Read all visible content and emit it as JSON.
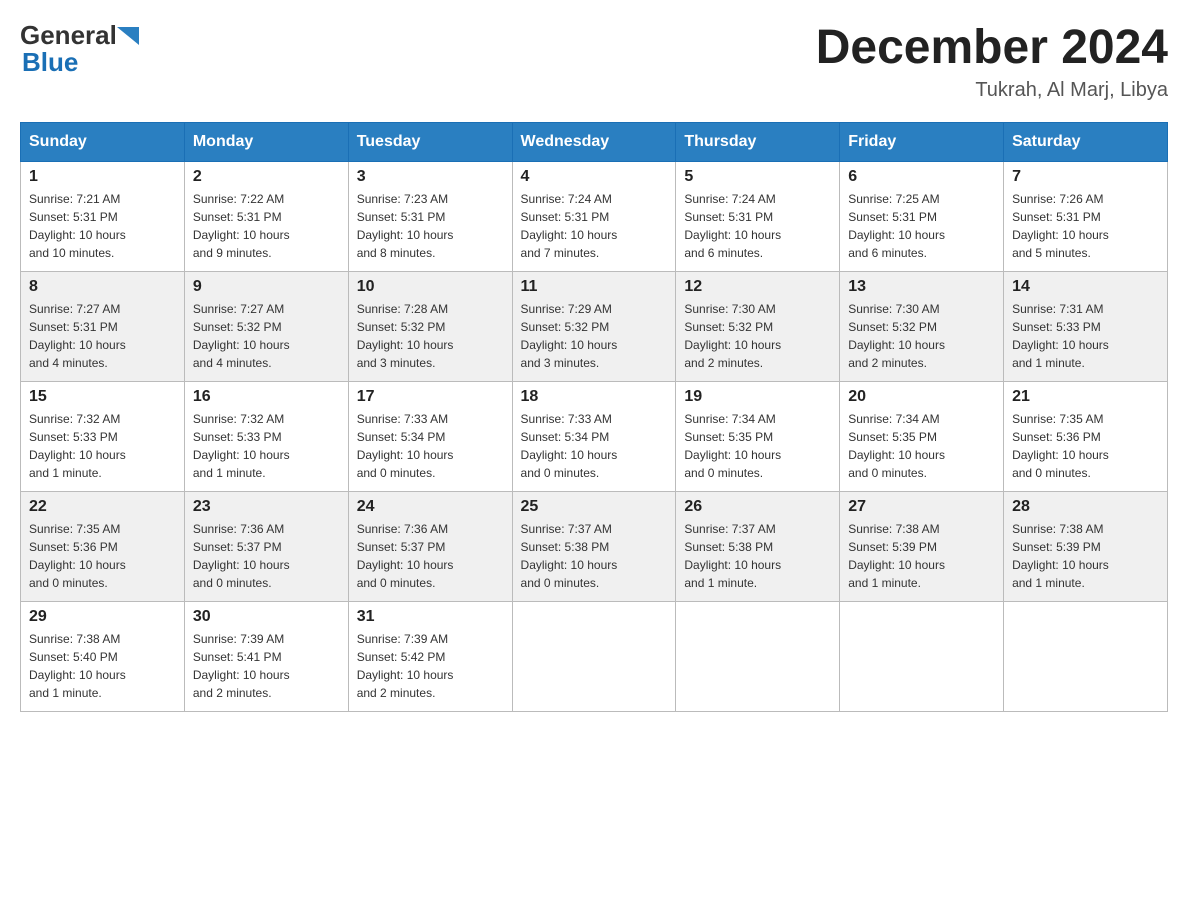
{
  "logo": {
    "line1": "General",
    "line2": "Blue"
  },
  "header": {
    "month_year": "December 2024",
    "location": "Tukrah, Al Marj, Libya"
  },
  "weekdays": [
    "Sunday",
    "Monday",
    "Tuesday",
    "Wednesday",
    "Thursday",
    "Friday",
    "Saturday"
  ],
  "weeks": [
    [
      {
        "day": "1",
        "sunrise": "7:21 AM",
        "sunset": "5:31 PM",
        "daylight": "10 hours and 10 minutes."
      },
      {
        "day": "2",
        "sunrise": "7:22 AM",
        "sunset": "5:31 PM",
        "daylight": "10 hours and 9 minutes."
      },
      {
        "day": "3",
        "sunrise": "7:23 AM",
        "sunset": "5:31 PM",
        "daylight": "10 hours and 8 minutes."
      },
      {
        "day": "4",
        "sunrise": "7:24 AM",
        "sunset": "5:31 PM",
        "daylight": "10 hours and 7 minutes."
      },
      {
        "day": "5",
        "sunrise": "7:24 AM",
        "sunset": "5:31 PM",
        "daylight": "10 hours and 6 minutes."
      },
      {
        "day": "6",
        "sunrise": "7:25 AM",
        "sunset": "5:31 PM",
        "daylight": "10 hours and 6 minutes."
      },
      {
        "day": "7",
        "sunrise": "7:26 AM",
        "sunset": "5:31 PM",
        "daylight": "10 hours and 5 minutes."
      }
    ],
    [
      {
        "day": "8",
        "sunrise": "7:27 AM",
        "sunset": "5:31 PM",
        "daylight": "10 hours and 4 minutes."
      },
      {
        "day": "9",
        "sunrise": "7:27 AM",
        "sunset": "5:32 PM",
        "daylight": "10 hours and 4 minutes."
      },
      {
        "day": "10",
        "sunrise": "7:28 AM",
        "sunset": "5:32 PM",
        "daylight": "10 hours and 3 minutes."
      },
      {
        "day": "11",
        "sunrise": "7:29 AM",
        "sunset": "5:32 PM",
        "daylight": "10 hours and 3 minutes."
      },
      {
        "day": "12",
        "sunrise": "7:30 AM",
        "sunset": "5:32 PM",
        "daylight": "10 hours and 2 minutes."
      },
      {
        "day": "13",
        "sunrise": "7:30 AM",
        "sunset": "5:32 PM",
        "daylight": "10 hours and 2 minutes."
      },
      {
        "day": "14",
        "sunrise": "7:31 AM",
        "sunset": "5:33 PM",
        "daylight": "10 hours and 1 minute."
      }
    ],
    [
      {
        "day": "15",
        "sunrise": "7:32 AM",
        "sunset": "5:33 PM",
        "daylight": "10 hours and 1 minute."
      },
      {
        "day": "16",
        "sunrise": "7:32 AM",
        "sunset": "5:33 PM",
        "daylight": "10 hours and 1 minute."
      },
      {
        "day": "17",
        "sunrise": "7:33 AM",
        "sunset": "5:34 PM",
        "daylight": "10 hours and 0 minutes."
      },
      {
        "day": "18",
        "sunrise": "7:33 AM",
        "sunset": "5:34 PM",
        "daylight": "10 hours and 0 minutes."
      },
      {
        "day": "19",
        "sunrise": "7:34 AM",
        "sunset": "5:35 PM",
        "daylight": "10 hours and 0 minutes."
      },
      {
        "day": "20",
        "sunrise": "7:34 AM",
        "sunset": "5:35 PM",
        "daylight": "10 hours and 0 minutes."
      },
      {
        "day": "21",
        "sunrise": "7:35 AM",
        "sunset": "5:36 PM",
        "daylight": "10 hours and 0 minutes."
      }
    ],
    [
      {
        "day": "22",
        "sunrise": "7:35 AM",
        "sunset": "5:36 PM",
        "daylight": "10 hours and 0 minutes."
      },
      {
        "day": "23",
        "sunrise": "7:36 AM",
        "sunset": "5:37 PM",
        "daylight": "10 hours and 0 minutes."
      },
      {
        "day": "24",
        "sunrise": "7:36 AM",
        "sunset": "5:37 PM",
        "daylight": "10 hours and 0 minutes."
      },
      {
        "day": "25",
        "sunrise": "7:37 AM",
        "sunset": "5:38 PM",
        "daylight": "10 hours and 0 minutes."
      },
      {
        "day": "26",
        "sunrise": "7:37 AM",
        "sunset": "5:38 PM",
        "daylight": "10 hours and 1 minute."
      },
      {
        "day": "27",
        "sunrise": "7:38 AM",
        "sunset": "5:39 PM",
        "daylight": "10 hours and 1 minute."
      },
      {
        "day": "28",
        "sunrise": "7:38 AM",
        "sunset": "5:39 PM",
        "daylight": "10 hours and 1 minute."
      }
    ],
    [
      {
        "day": "29",
        "sunrise": "7:38 AM",
        "sunset": "5:40 PM",
        "daylight": "10 hours and 1 minute."
      },
      {
        "day": "30",
        "sunrise": "7:39 AM",
        "sunset": "5:41 PM",
        "daylight": "10 hours and 2 minutes."
      },
      {
        "day": "31",
        "sunrise": "7:39 AM",
        "sunset": "5:42 PM",
        "daylight": "10 hours and 2 minutes."
      },
      null,
      null,
      null,
      null
    ]
  ],
  "labels": {
    "sunrise": "Sunrise:",
    "sunset": "Sunset:",
    "daylight": "Daylight:"
  }
}
